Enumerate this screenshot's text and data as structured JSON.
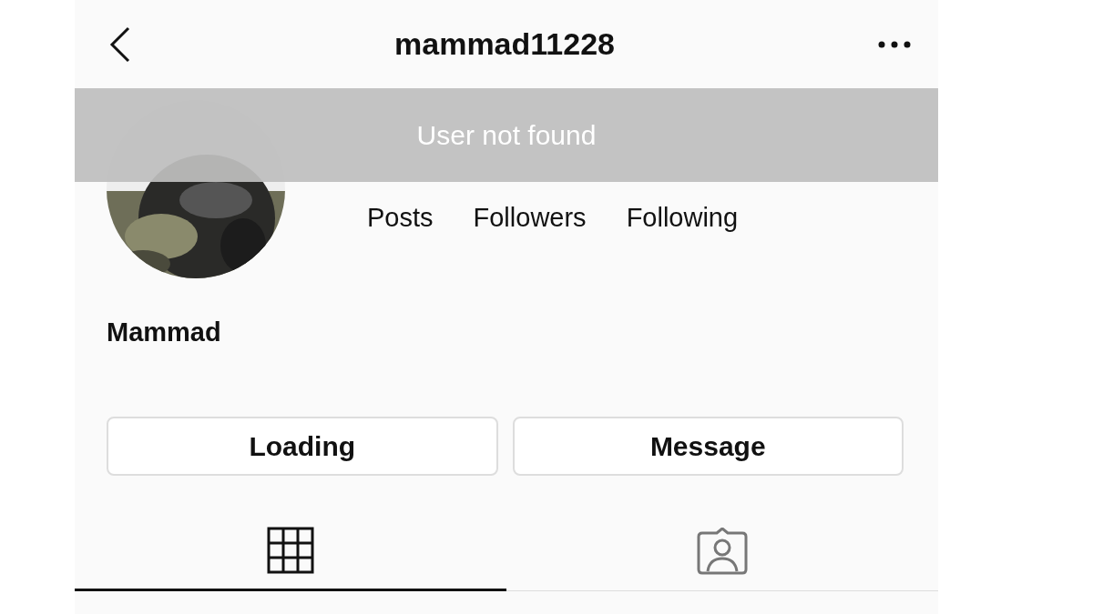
{
  "header": {
    "title": "mammad11228"
  },
  "toast": {
    "text": "User not found"
  },
  "avatar": {
    "kind": "picture"
  },
  "stats": [
    {
      "label": "Posts"
    },
    {
      "label": "Followers"
    },
    {
      "label": "Following"
    }
  ],
  "profile": {
    "name": "Mammad"
  },
  "buttons": [
    "Loading",
    "Message"
  ],
  "tabs": [
    {
      "kind": "grid",
      "selected": true
    },
    {
      "kind": "tagged",
      "selected": false
    }
  ]
}
